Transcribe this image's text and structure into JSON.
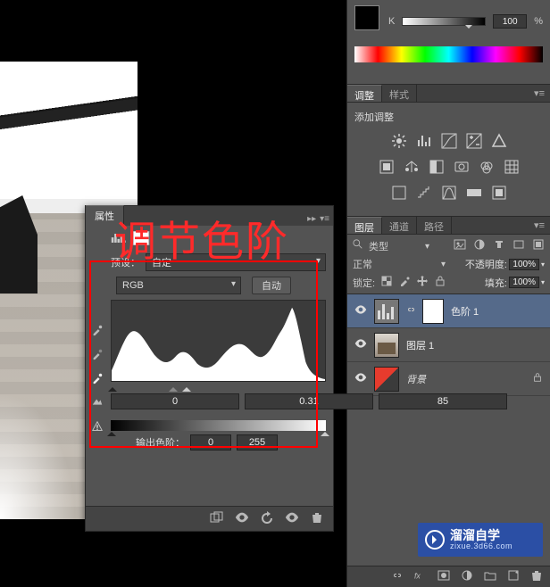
{
  "overlay_title": "调节色阶",
  "color": {
    "mode_label": "K",
    "value": "100",
    "percent": "%"
  },
  "adjust_panel": {
    "tab": "调整",
    "secondary_tab": "样式",
    "label": "添加调整"
  },
  "properties": {
    "tab": "属性",
    "preset_label": "预设：",
    "preset_value": "自定",
    "channel_value": "RGB",
    "auto_btn": "自动",
    "in_black": "0",
    "in_gamma": "0.31",
    "in_white": "85",
    "out_label": "输出色阶：",
    "out_black": "0",
    "out_white": "255"
  },
  "layers_panel": {
    "tabs": [
      "图层",
      "通道",
      "路径"
    ],
    "kind_label": "类型",
    "blend_mode": "正常",
    "opacity_label": "不透明度:",
    "opacity_value": "100%",
    "lock_label": "锁定:",
    "fill_label": "填充:",
    "fill_value": "100%",
    "items": [
      {
        "label": "色阶 1"
      },
      {
        "label": "图层 1"
      },
      {
        "label": "背景"
      }
    ]
  },
  "watermark": {
    "title": "溜溜自学",
    "sub": "zixue.3d66.com"
  }
}
